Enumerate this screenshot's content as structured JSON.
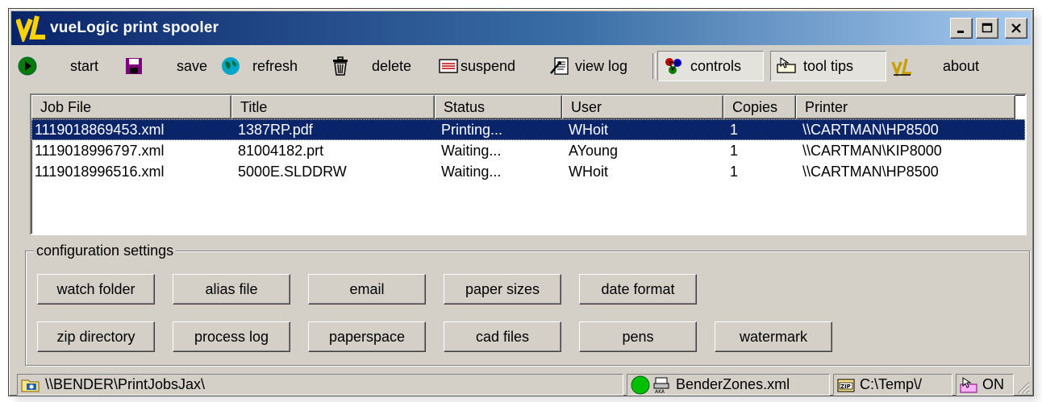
{
  "window": {
    "title": "vueLogic print spooler"
  },
  "toolbar": {
    "start": "start",
    "save": "save",
    "refresh": "refresh",
    "delete": "delete",
    "suspend": "suspend",
    "view_log": "view log",
    "controls": "controls",
    "tool_tips": "tool tips",
    "about": "about"
  },
  "jobs": {
    "columns": [
      "Job File",
      "Title",
      "Status",
      "User",
      "Copies",
      "Printer"
    ],
    "rows": [
      {
        "job_file": "1119018869453.xml",
        "title": "1387RP.pdf",
        "status": "Printing...",
        "user": "WHoit",
        "copies": "1",
        "printer": "\\\\CARTMAN\\HP8500",
        "selected": true
      },
      {
        "job_file": "1119018996797.xml",
        "title": "81004182.prt",
        "status": "Waiting...",
        "user": "AYoung",
        "copies": "1",
        "printer": "\\\\CARTMAN\\KIP8000",
        "selected": false
      },
      {
        "job_file": "1119018996516.xml",
        "title": "5000E.SLDDRW",
        "status": "Waiting...",
        "user": "WHoit",
        "copies": "1",
        "printer": "\\\\CARTMAN\\HP8500",
        "selected": false
      }
    ]
  },
  "config": {
    "legend": "configuration settings",
    "watch_folder": "watch folder",
    "alias_file": "alias file",
    "email": "email",
    "paper_sizes": "paper sizes",
    "date_format": "date format",
    "zip_directory": "zip directory",
    "process_log": "process log",
    "paperspace": "paperspace",
    "cad_files": "cad files",
    "pens": "pens",
    "watermark": "watermark"
  },
  "status": {
    "path": "\\\\BENDER\\PrintJobsJax\\",
    "alias_file": "BenderZones.xml",
    "zip_path": "C:\\Temp\\/",
    "tooltip_state": "ON",
    "status_color": "#00c000"
  },
  "icons": {
    "title_logo": "vuelogic-logo",
    "start": "play-icon",
    "save": "floppy-disk-icon",
    "refresh": "globe-icon",
    "delete": "trash-can-icon",
    "suspend": "suspend-icon",
    "view_log": "log-icon",
    "controls": "controls-icon",
    "tool_tips": "tool-tips-icon",
    "about": "vuelogic-icon"
  }
}
